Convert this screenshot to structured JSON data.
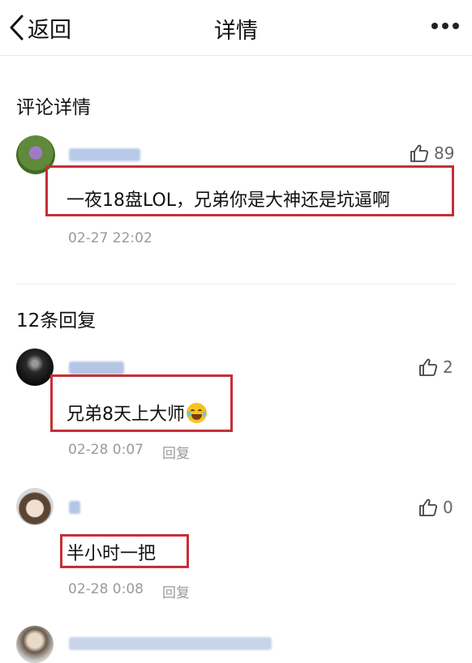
{
  "nav": {
    "back_label": "返回",
    "title": "详情"
  },
  "comment_section": {
    "title": "评论详情"
  },
  "main_comment": {
    "text": "一夜18盘LOL，兄弟你是大神还是坑逼啊",
    "likes": "89",
    "time": "02-27 22:02"
  },
  "replies_section": {
    "title": "12条回复"
  },
  "replies": [
    {
      "text": "兄弟8天上大师",
      "likes": "2",
      "time": "02-28 0:07",
      "reply_label": "回复"
    },
    {
      "text": "半小时一把",
      "likes": "0",
      "time": "02-28 0:08",
      "reply_label": "回复"
    }
  ],
  "colors": {
    "highlight_box": "#c62f38",
    "meta_text": "#9a9a9a",
    "divider": "#ececec"
  },
  "icons": {
    "back": "chevron-left-icon",
    "more": "more-dots-icon",
    "like": "thumbs-up-icon"
  }
}
